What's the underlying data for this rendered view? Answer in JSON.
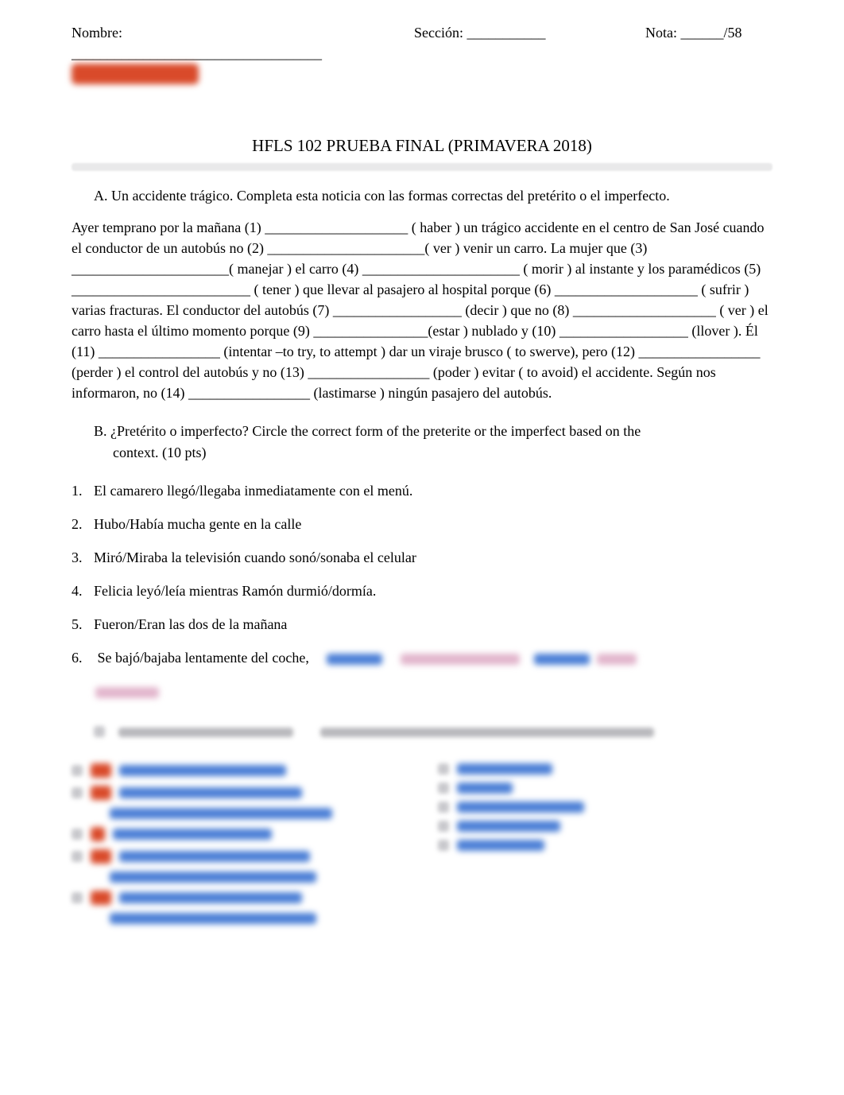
{
  "header": {
    "nombre_label": "Nombre: ___________________________________",
    "seccion_label": "Sección: ___________",
    "nota_label": "Nota: ______/58"
  },
  "title": "HFLS 102 PRUEBA FINAL (PRIMAVERA 2018)",
  "sectionA": {
    "head": "A.    Un accidente trágico.     Completa esta noticia con las formas correctas del pretérito o el imperfecto.",
    "paragraph": "Ayer temprano por la mañana (1) ____________________ (     haber  ) un trágico accidente en el centro de San José cuando el conductor de un autobús no (2) ______________________(      ver ) venir un carro. La mujer que (3) ______________________(  manejar  ) el carro (4) ______________________ ( morir  ) al instante y los paramédicos (5) _________________________ (    tener ) que llevar al pasajero al hospital porque (6) ____________________  ( sufrir ) varias fracturas. El conductor del autobús (7) __________________ (decir ) que no (8) ____________________ ( ver ) el carro hasta el último momento porque (9)  ________________(estar ) nublado y (10)  __________________ (llover ). Él (11) _________________ (intentar  –to try, to attempt ) dar un viraje brusco (   to swerve), pero (12) _________________ (perder  ) el control del autobús y no (13)   _________________ (poder ) evitar ( to avoid) el accidente. Según nos informaron, no (14)      _________________ (lastimarse   ) ningún pasajero del autobús."
  },
  "sectionB": {
    "head_line1": "B.    ¿Pretérito o imperfecto?      Circle the correct form of the preterite or the imperfect based on the",
    "head_line2": "context. (10 pts)",
    "items": [
      "El camarero  llegó/llegaba   inmediatamente con el menú.",
      "Hubo/Había    mucha gente en la calle",
      "Miró/Miraba   la televisión cuando    sonó/sonaba   el celular",
      "Felicia leyó/leía  mientras Ramón   durmió/dormía.",
      "Fueron/Eran   las dos de la mañana",
      "Se bajó/bajaba   lentamente del coche,"
    ]
  }
}
